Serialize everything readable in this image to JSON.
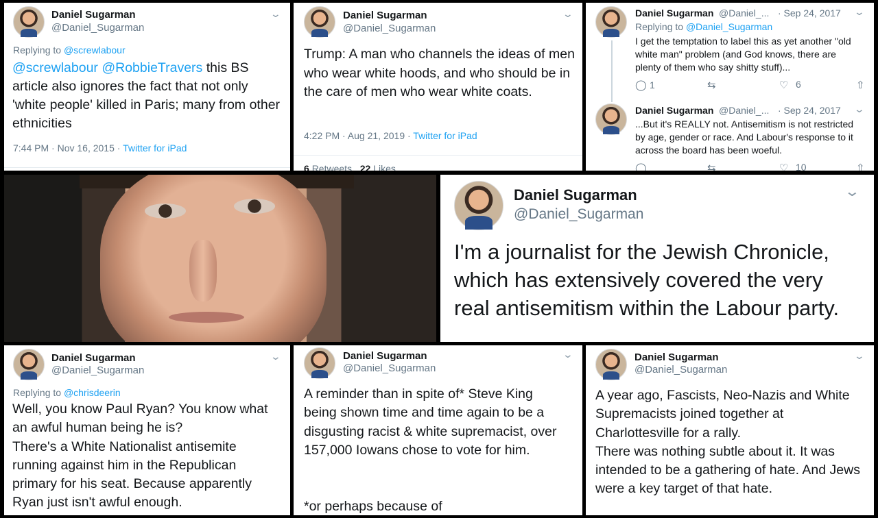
{
  "tweets": {
    "t1": {
      "name": "Daniel Sugarman",
      "handle": "@Daniel_Sugarman",
      "replying_prefix": "Replying to",
      "replying_to": "@screwlabour",
      "mentions": "@screwlabour @RobbieTravers",
      "body": "this BS article also ignores the fact that not only 'white people' killed in Paris; many from other ethnicities",
      "time": "7:44 PM · Nov 16, 2015 · ",
      "source": "Twitter for iPad"
    },
    "t2": {
      "name": "Daniel Sugarman",
      "handle": "@Daniel_Sugarman",
      "body": "Trump: A man who channels the ideas of men who wear white hoods, and who should be in the care of men who wear white coats.",
      "time": "4:22 PM · Aug 21, 2019 · ",
      "source": "Twitter for iPad",
      "retweets_count": "6",
      "retweets_label": "Retweets",
      "likes_count": "22",
      "likes_label": "Likes"
    },
    "t3a": {
      "name": "Daniel Sugarman",
      "handle": "@Daniel_...",
      "date": "· Sep 24, 2017",
      "replying_prefix": "Replying to",
      "replying_to": "@Daniel_Sugarman",
      "body": "I get the temptation to label this as yet another \"old white man\" problem (and God knows, there are plenty of them who say shitty stuff)...",
      "replies": "1",
      "likes": "6"
    },
    "t3b": {
      "name": "Daniel Sugarman",
      "handle": "@Daniel_...",
      "date": "· Sep 24, 2017",
      "body": "...But it's REALLY not. Antisemitism is not restricted by age, gender or race. And Labour's response to it across the board has been woeful.",
      "likes": "10"
    },
    "t4": {
      "name": "Daniel Sugarman",
      "handle": "@Daniel_Sugarman",
      "body": "I'm a journalist for the Jewish Chronicle, which has extensively covered the very real antisemitism within the Labour party."
    },
    "t5": {
      "name": "Daniel Sugarman",
      "handle": "@Daniel_Sugarman",
      "replying_prefix": "Replying to",
      "replying_to": "@chrisdeerin",
      "body_p1": "Well, you know Paul Ryan? You know what an awful human being he is?",
      "body_p2": "There's a White Nationalist antisemite running against him in the Republican primary for his seat. Because apparently Ryan just isn't awful enough."
    },
    "t6": {
      "name": "Daniel Sugarman",
      "handle": "@Daniel_Sugarman",
      "body": "A reminder than in spite of* Steve King being shown time and time again to be a disgusting racist & white supremacist, over 157,000 Iowans chose to vote for him.",
      "footnote": "*or perhaps because of"
    },
    "t7": {
      "name": "Daniel Sugarman",
      "handle": "@Daniel_Sugarman",
      "body_p1": "A year ago, Fascists, Neo-Nazis and White Supremacists joined together at Charlottesville for a rally.",
      "body_p2": "There was nothing subtle about it. It was intended to be a gathering of hate. And Jews were a key target of that hate."
    }
  },
  "icons": {
    "chevron": "⌄",
    "reply": "reply-icon",
    "retweet": "retweet-icon",
    "like": "heart-icon",
    "share": "share-icon"
  },
  "colors": {
    "link": "#1da1f2",
    "meta": "#657786",
    "text": "#14171a"
  }
}
